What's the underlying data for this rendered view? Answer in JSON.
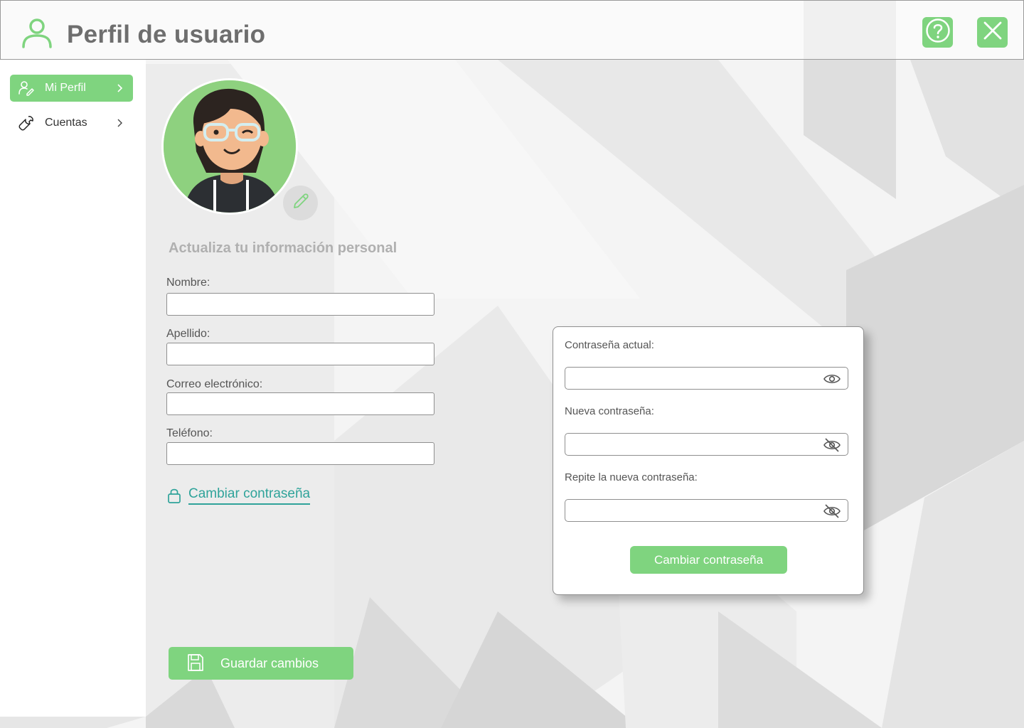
{
  "header": {
    "title": "Perfil de usuario",
    "help_icon": "question-circle-icon",
    "close_icon": "close-x-icon"
  },
  "sidebar": {
    "items": [
      {
        "label": "Mi Perfil",
        "icon": "user-edit-icon",
        "active": true
      },
      {
        "label": "Cuentas",
        "icon": "wrench-icon",
        "active": false
      }
    ]
  },
  "profile": {
    "section_title": "Actualiza tu información personal",
    "fields": [
      {
        "label": "Nombre:",
        "value": "",
        "placeholder": ""
      },
      {
        "label": "Apellido:",
        "value": "",
        "placeholder": ""
      },
      {
        "label": "Correo electrónico:",
        "value": "",
        "placeholder": ""
      },
      {
        "label": "Teléfono:",
        "value": "",
        "placeholder": ""
      }
    ],
    "change_password_link": "Cambiar contraseña",
    "save_button": "Guardar cambios"
  },
  "password_panel": {
    "fields": [
      {
        "label": "Contraseña actual:",
        "icon": "eye-icon"
      },
      {
        "label": "Nueva contraseña:",
        "icon": "eye-off-icon"
      },
      {
        "label": "Repite la nueva contraseña:",
        "icon": "eye-off-icon"
      }
    ],
    "button": "Cambiar contraseña"
  },
  "colors": {
    "accent": "#7fd47f",
    "link": "#2fa39a",
    "title": "#6e6e6e",
    "muted": "#b0b0b0"
  }
}
